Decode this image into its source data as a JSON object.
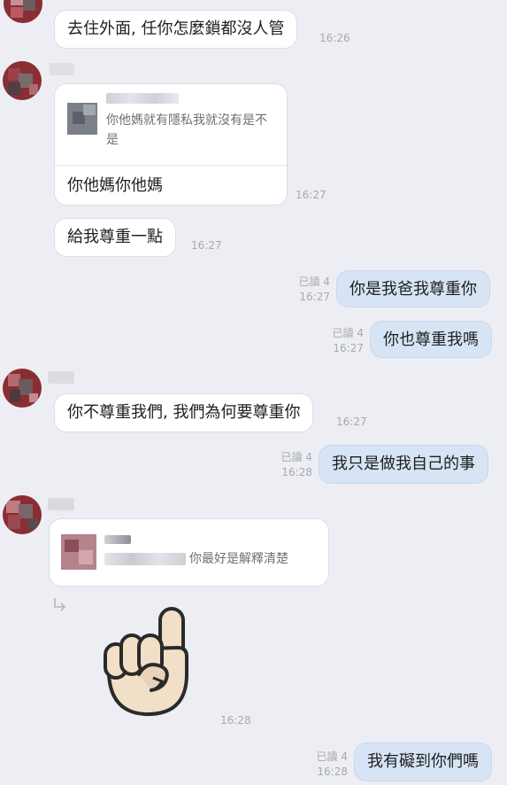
{
  "messages": {
    "m1": {
      "text": "去住外面, 任你怎麼鎖都沒人管",
      "time": "16:26"
    },
    "m2": {
      "quote_text": "你他媽就有隱私我就沒有是不是",
      "text": "你他媽你他媽",
      "time": "16:27"
    },
    "m3": {
      "text": "給我尊重一點",
      "time": "16:27"
    },
    "m4": {
      "text": "你是我爸我尊重你",
      "read": "已讀 4",
      "time": "16:27"
    },
    "m5": {
      "text": "你也尊重我嗎",
      "read": "已讀 4",
      "time": "16:27"
    },
    "m6": {
      "text": "你不尊重我們, 我們為何要尊重你",
      "time": "16:27"
    },
    "m7": {
      "text": "我只是做我自己的事",
      "read": "已讀 4",
      "time": "16:28"
    },
    "m8": {
      "quote_text": "你最好是解釋清楚",
      "time": "16:28"
    },
    "m9": {
      "text": "我有礙到你們嗎",
      "read": "已讀 4",
      "time": "16:28"
    }
  },
  "icons": {
    "reply_arrow": "reply-arrow-icon",
    "sticker": "pointing-up-hand-sticker"
  },
  "colors": {
    "background": "#edeef4",
    "incoming_bubble": "#ffffff",
    "outgoing_bubble": "#d6e4f6",
    "meta_text": "#a7a9b1"
  }
}
